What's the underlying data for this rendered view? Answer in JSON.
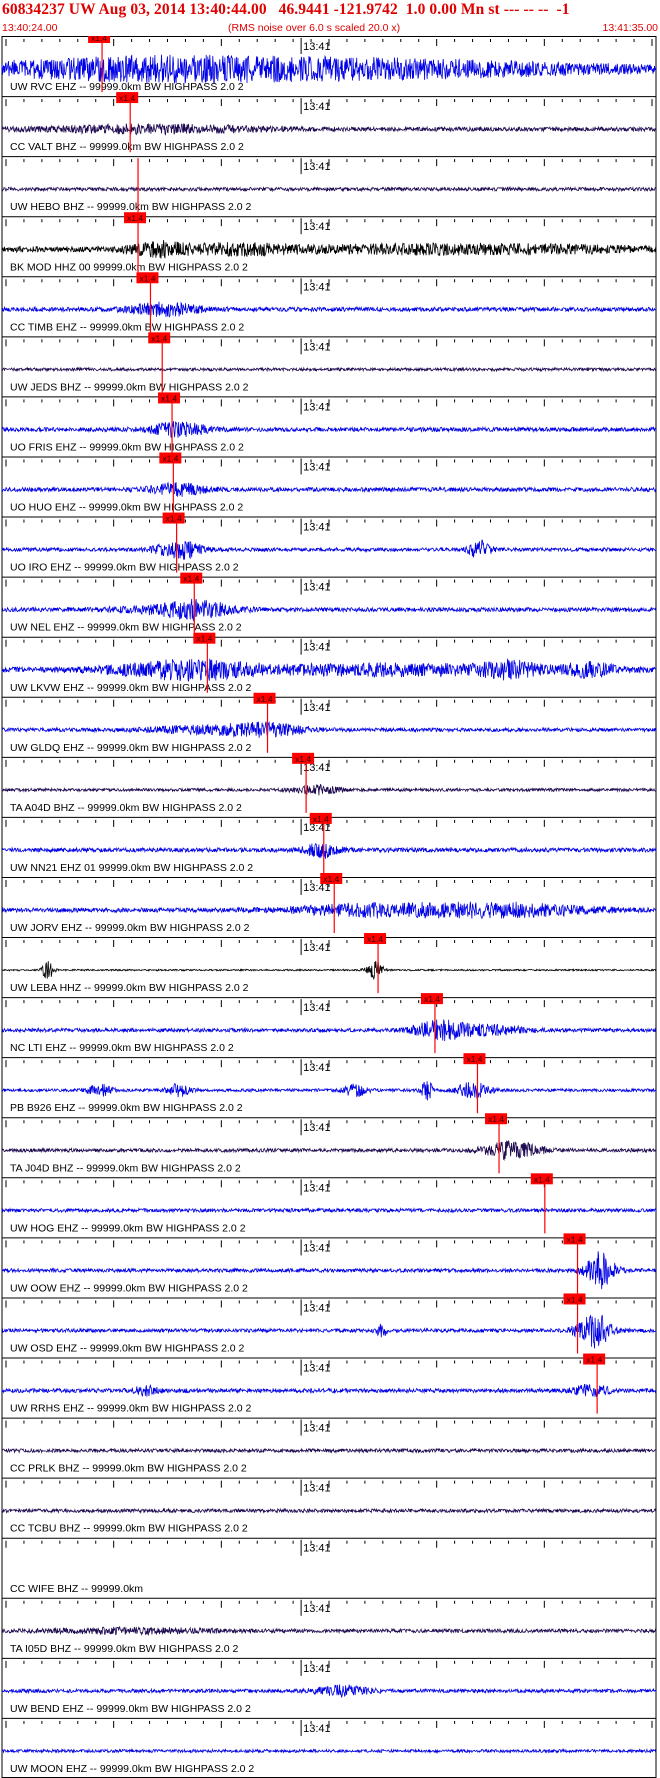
{
  "header": {
    "title": "60834237 UW Aug 03, 2014 13:40:44.00   46.9441 -121.9742  1.0 0.00 Mn st --- -- --  -1",
    "start_time": "13:40:24.00",
    "note": "(RMS noise over 6.0 s scaled 20.0 x)",
    "end_time": "13:41:35.00"
  },
  "chart_data": {
    "type": "seismogram",
    "time_start": "13:40:24.00",
    "time_end": "13:41:35.00",
    "tick_label": "13:41",
    "pick_label": "x1.4",
    "colors": {
      "trace_blue": "#0000e6",
      "trace_navy": "#1e0a50",
      "trace_black": "#000000",
      "pick": "#ff0000",
      "text": "#e00000"
    },
    "traces": [
      {
        "label": "UW RVC EHZ -- 99999.0km BW  HIGHPASS  2.0  2",
        "color": "blue",
        "pick": 0.153,
        "amp": 0.5,
        "events": [
          [
            0.24,
            0.15,
            0.6
          ],
          [
            0.38,
            0.65,
            4.0
          ]
        ],
        "show_pick_label": true
      },
      {
        "label": "CC VALT BHZ -- 99999.0km BW  HIGHPASS  2.0  2",
        "color": "navy",
        "pick": 0.196,
        "amp": 0.7,
        "events": [
          [
            0.23,
            0.2,
            1.2
          ]
        ],
        "show_pick_label": true
      },
      {
        "label": "UW HEBO BHZ -- 99999.0km BW  HIGHPASS  2.0  2",
        "color": "navy",
        "pick": 0.208,
        "amp": 0.6,
        "events": [],
        "show_pick_label": false
      },
      {
        "label": "BK MOD HHZ 00 99999.0km BW  HIGHPASS  2.0  2",
        "color": "black",
        "pick": 0.208,
        "amp": 1.0,
        "events": [
          [
            0.24,
            0.05,
            2.0
          ],
          [
            0.36,
            0.1,
            1.3
          ],
          [
            0.7,
            0.3,
            1.2
          ]
        ],
        "show_pick_label": true
      },
      {
        "label": "CC TIMB EHZ -- 99999.0km BW  HIGHPASS  2.0  2",
        "color": "blue",
        "pick": 0.227,
        "amp": 0.7,
        "events": [
          [
            0.25,
            0.06,
            2.0
          ]
        ],
        "show_pick_label": true
      },
      {
        "label": "UW JEDS BHZ -- 99999.0km BW  HIGHPASS  2.0  2",
        "color": "navy",
        "pick": 0.245,
        "amp": 0.5,
        "events": [],
        "show_pick_label": true
      },
      {
        "label": "UO FRIS EHZ -- 99999.0km BW  HIGHPASS  2.0  2",
        "color": "blue",
        "pick": 0.26,
        "amp": 0.7,
        "events": [
          [
            0.27,
            0.05,
            2.3
          ]
        ],
        "show_pick_label": true
      },
      {
        "label": "UO HUO EHZ -- 99999.0km BW  HIGHPASS  2.0  2",
        "color": "blue",
        "pick": 0.262,
        "amp": 0.7,
        "events": [
          [
            0.27,
            0.05,
            1.8
          ]
        ],
        "show_pick_label": true
      },
      {
        "label": "UO IRO EHZ -- 99999.0km BW  HIGHPASS  2.0  2",
        "color": "blue",
        "pick": 0.267,
        "amp": 0.6,
        "events": [
          [
            0.27,
            0.04,
            3.0
          ],
          [
            0.73,
            0.02,
            2.8
          ]
        ],
        "show_pick_label": true
      },
      {
        "label": "UW NEL EHZ -- 99999.0km BW  HIGHPASS  2.0  2",
        "color": "blue",
        "pick": 0.294,
        "amp": 0.7,
        "events": [
          [
            0.3,
            0.06,
            2.3
          ],
          [
            0.25,
            0.1,
            1.0
          ]
        ],
        "show_pick_label": true
      },
      {
        "label": "UW LKVW EHZ -- 99999.0km BW  HIGHPASS  2.0  2",
        "color": "blue",
        "pick": 0.314,
        "amp": 0.9,
        "events": [
          [
            0.28,
            0.12,
            3.0
          ],
          [
            0.6,
            0.25,
            1.6
          ],
          [
            0.78,
            0.05,
            2.0
          ],
          [
            0.9,
            0.05,
            2.0
          ]
        ],
        "show_pick_label": true
      },
      {
        "label": "UW GLDQ EHZ -- 99999.0km BW  HIGHPASS  2.0  2",
        "color": "blue",
        "pick": 0.406,
        "amp": 0.6,
        "events": [
          [
            0.4,
            0.08,
            2.0
          ],
          [
            0.3,
            0.1,
            1.0
          ]
        ],
        "show_pick_label": true
      },
      {
        "label": "TA A04D BHZ -- 99999.0km BW  HIGHPASS  2.0  2",
        "color": "navy",
        "pick": 0.465,
        "amp": 0.5,
        "events": [
          [
            0.48,
            0.04,
            1.4
          ]
        ],
        "show_pick_label": true
      },
      {
        "label": "UW NN21 EHZ 01 99999.0km BW  HIGHPASS  2.0  2",
        "color": "blue",
        "pick": 0.492,
        "amp": 0.7,
        "events": [
          [
            0.49,
            0.03,
            2.4
          ]
        ],
        "show_pick_label": true
      },
      {
        "label": "UW JORV EHZ -- 99999.0km BW  HIGHPASS  2.0  2",
        "color": "blue",
        "pick": 0.508,
        "amp": 0.7,
        "events": [
          [
            0.58,
            0.15,
            2.0
          ],
          [
            0.78,
            0.15,
            2.0
          ]
        ],
        "show_pick_label": true
      },
      {
        "label": "UW LEBA HHZ -- 99999.0km BW  HIGHPASS  2.0  2",
        "color": "black",
        "pick": 0.575,
        "amp": 0.25,
        "events": [
          [
            0.07,
            0.01,
            3.0
          ],
          [
            0.57,
            0.015,
            3.0
          ]
        ],
        "show_pick_label": true
      },
      {
        "label": "NC LTI EHZ -- 99999.0km BW  HIGHPASS  2.0  2",
        "color": "blue",
        "pick": 0.662,
        "amp": 0.6,
        "events": [
          [
            0.67,
            0.05,
            3.0
          ],
          [
            0.75,
            0.06,
            1.4
          ]
        ],
        "show_pick_label": true
      },
      {
        "label": "PB B926 EHZ -- 99999.0km BW  HIGHPASS  2.0  2",
        "color": "blue",
        "pick": 0.727,
        "amp": 0.5,
        "events": [
          [
            0.15,
            0.02,
            2.0
          ],
          [
            0.27,
            0.02,
            2.0
          ],
          [
            0.54,
            0.02,
            2.0
          ],
          [
            0.65,
            0.01,
            3.0
          ],
          [
            0.72,
            0.03,
            2.5
          ]
        ],
        "show_pick_label": true
      },
      {
        "label": "TA J04D BHZ -- 99999.0km BW  HIGHPASS  2.0  2",
        "color": "navy",
        "pick": 0.76,
        "amp": 0.6,
        "events": [
          [
            0.78,
            0.05,
            2.8
          ]
        ],
        "show_pick_label": true
      },
      {
        "label": "UW HOG EHZ -- 99999.0km BW  HIGHPASS  2.0  2",
        "color": "blue",
        "pick": 0.83,
        "amp": 0.6,
        "events": [],
        "show_pick_label": true
      },
      {
        "label": "UW OOW EHZ -- 99999.0km BW  HIGHPASS  2.0  2",
        "color": "blue",
        "pick": 0.88,
        "amp": 0.6,
        "events": [
          [
            0.915,
            0.025,
            6.0
          ]
        ],
        "show_pick_label": true
      },
      {
        "label": "UW OSD EHZ -- 99999.0km BW  HIGHPASS  2.0  2",
        "color": "blue",
        "pick": 0.88,
        "amp": 0.6,
        "events": [
          [
            0.58,
            0.01,
            2.0
          ],
          [
            0.905,
            0.03,
            6.0
          ]
        ],
        "show_pick_label": true
      },
      {
        "label": "UW RRHS EHZ -- 99999.0km BW  HIGHPASS  2.0  2",
        "color": "blue",
        "pick": 0.91,
        "amp": 0.7,
        "events": [
          [
            0.22,
            0.02,
            1.6
          ],
          [
            0.9,
            0.03,
            1.8
          ]
        ],
        "show_pick_label": true
      },
      {
        "label": "CC PRLK BHZ -- 99999.0km BW  HIGHPASS  2.0  2",
        "color": "navy",
        "pick": null,
        "amp": 0.6,
        "events": [],
        "show_pick_label": false
      },
      {
        "label": "CC TCBU BHZ -- 99999.0km BW  HIGHPASS  2.0  2",
        "color": "navy",
        "pick": null,
        "amp": 0.6,
        "events": [],
        "show_pick_label": false
      },
      {
        "label": "CC WIFE BHZ -- 99999.0km",
        "color": "none",
        "pick": null,
        "amp": 0.0,
        "events": [],
        "show_pick_label": false
      },
      {
        "label": "TA I05D BHZ -- 99999.0km BW  HIGHPASS  2.0  2",
        "color": "navy",
        "pick": null,
        "amp": 0.6,
        "events": [
          [
            0.2,
            0.15,
            0.8
          ]
        ],
        "show_pick_label": false
      },
      {
        "label": "UW BEND EHZ -- 99999.0km BW  HIGHPASS  2.0  2",
        "color": "blue",
        "pick": null,
        "amp": 0.6,
        "events": [
          [
            0.52,
            0.05,
            1.6
          ]
        ],
        "show_pick_label": false
      },
      {
        "label": "UW MOON EHZ -- 99999.0km BW  HIGHPASS  2.0  2",
        "color": "blue",
        "pick": null,
        "amp": 0.5,
        "events": [],
        "show_pick_label": false
      }
    ]
  }
}
